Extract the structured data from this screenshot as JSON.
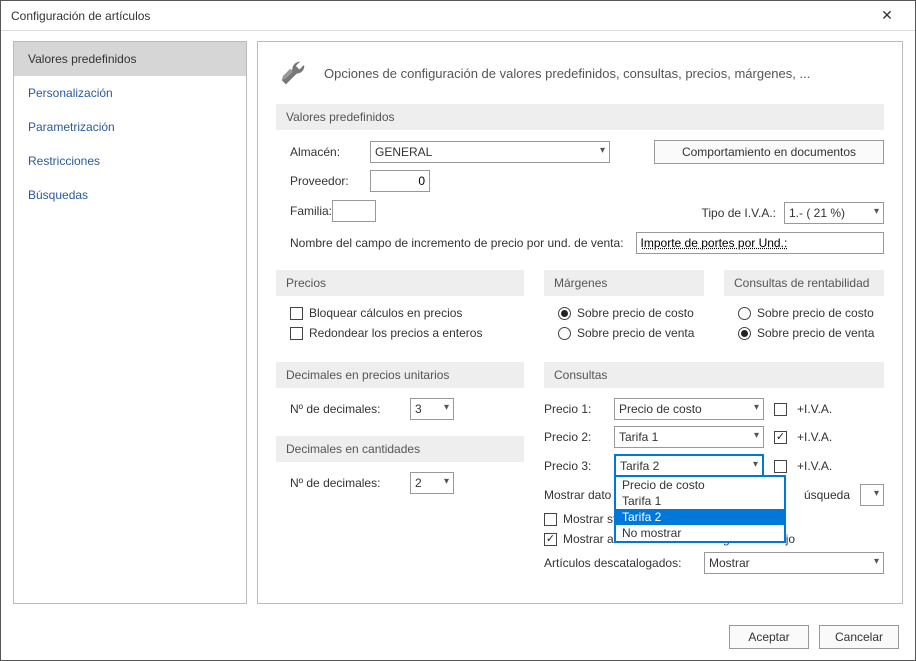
{
  "window": {
    "title": "Configuración de artículos"
  },
  "sidebar": {
    "items": [
      {
        "label": "Valores predefinidos",
        "active": true
      },
      {
        "label": "Personalización"
      },
      {
        "label": "Parametrización"
      },
      {
        "label": "Restricciones"
      },
      {
        "label": "Búsquedas"
      }
    ]
  },
  "header": {
    "text": "Opciones de configuración de valores predefinidos, consultas, precios, márgenes, ..."
  },
  "predef": {
    "section": "Valores predefinidos",
    "almacen_label": "Almacén:",
    "almacen_value": "GENERAL",
    "proveedor_label": "Proveedor:",
    "proveedor_value": "0",
    "familia_label": "Familia:",
    "familia_value": "",
    "comport_btn": "Comportamiento en documentos",
    "tipoiva_label": "Tipo de I.V.A.:",
    "tipoiva_value": "1.- ( 21 %)",
    "incremento_label": "Nombre del campo de incremento de precio por und. de venta:",
    "incremento_value": "Importe de portes por Und.:"
  },
  "precios": {
    "section": "Precios",
    "bloquear": "Bloquear cálculos en precios",
    "redondear": "Redondear los precios a enteros"
  },
  "margenes": {
    "section": "Márgenes",
    "costo": "Sobre precio de costo",
    "venta": "Sobre precio de venta"
  },
  "rent": {
    "section": "Consultas de rentabilidad",
    "costo": "Sobre precio de costo",
    "venta": "Sobre precio de venta"
  },
  "dec_unit": {
    "section": "Decimales en precios unitarios",
    "label": "Nº de decimales:",
    "value": "3"
  },
  "dec_cant": {
    "section": "Decimales en cantidades",
    "label": "Nº de decimales:",
    "value": "2"
  },
  "consultas": {
    "section": "Consultas",
    "p1_label": "Precio 1:",
    "p1_value": "Precio de costo",
    "p2_label": "Precio 2:",
    "p2_value": "Tarifa 1",
    "p3_label": "Precio 3:",
    "p3_value": "Tarifa 2",
    "iva_label": "+I.V.A.",
    "mostrar_datos_label": "Mostrar dato",
    "mostrar_datos_cut": "úsqueda",
    "mostrar_stock_label": "Mostrar st",
    "mostrar_neg": "Mostrar artículos con stock negativo en rojo",
    "descat_label": "Artículos descatalogados:",
    "descat_value": "Mostrar",
    "dropdown": {
      "opt1": "Precio de costo",
      "opt2": "Tarifa 1",
      "opt3": "Tarifa 2",
      "opt4": "No mostrar"
    }
  },
  "footer": {
    "ok": "Aceptar",
    "cancel": "Cancelar"
  }
}
